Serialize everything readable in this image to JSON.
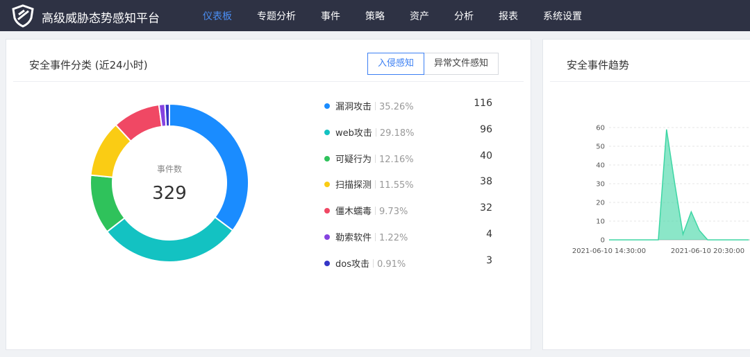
{
  "header": {
    "app_title": "高级威胁态势感知平台",
    "nav": [
      {
        "label": "仪表板",
        "active": true
      },
      {
        "label": "专题分析"
      },
      {
        "label": "事件"
      },
      {
        "label": "策略"
      },
      {
        "label": "资产"
      },
      {
        "label": "分析"
      },
      {
        "label": "报表"
      },
      {
        "label": "系统设置"
      }
    ]
  },
  "left_panel": {
    "title": "安全事件分类 (近24小时)",
    "tabs": [
      {
        "label": "入侵感知",
        "active": true
      },
      {
        "label": "异常文件感知"
      }
    ],
    "donut": {
      "label": "事件数",
      "total": "329"
    },
    "legend": [
      {
        "name": "漏洞攻击",
        "pct": "35.26%",
        "count": "116",
        "color": "#1a8cff"
      },
      {
        "name": "web攻击",
        "pct": "29.18%",
        "count": "96",
        "color": "#13c2c2"
      },
      {
        "name": "可疑行为",
        "pct": "12.16%",
        "count": "40",
        "color": "#2fc25b"
      },
      {
        "name": "扫描探测",
        "pct": "11.55%",
        "count": "38",
        "color": "#facc14"
      },
      {
        "name": "僵木蠕毒",
        "pct": "9.73%",
        "count": "32",
        "color": "#f04864"
      },
      {
        "name": "勒索软件",
        "pct": "1.22%",
        "count": "4",
        "color": "#8543e0"
      },
      {
        "name": "dos攻击",
        "pct": "0.91%",
        "count": "3",
        "color": "#3436c7"
      }
    ]
  },
  "right_panel": {
    "title": "安全事件趋势"
  },
  "chart_data": [
    {
      "type": "pie",
      "categories": [
        "漏洞攻击",
        "web攻击",
        "可疑行为",
        "扫描探测",
        "僵木蠕毒",
        "勒索软件",
        "dos攻击"
      ],
      "values": [
        116,
        96,
        40,
        38,
        32,
        4,
        3
      ],
      "colors": [
        "#1a8cff",
        "#13c2c2",
        "#2fc25b",
        "#facc14",
        "#f04864",
        "#8543e0",
        "#3436c7"
      ]
    },
    {
      "type": "area",
      "x_labels": [
        "2021-06-10 14:30:00",
        "2021-06-10 20:30:00"
      ],
      "y_ticks": [
        0,
        10,
        20,
        30,
        40,
        50,
        60
      ],
      "ylim": [
        0,
        60
      ],
      "x": [
        "2021-06-10 14:30:00",
        "2021-06-10 15:30:00",
        "2021-06-10 16:30:00",
        "2021-06-10 17:30:00",
        "2021-06-10 18:00:00",
        "2021-06-10 18:30:00",
        "2021-06-10 19:00:00",
        "2021-06-10 19:30:00",
        "2021-06-10 20:00:00",
        "2021-06-10 20:30:00",
        "2021-06-10 21:00:00",
        "2021-06-10 22:00:00",
        "2021-06-10 23:00:00"
      ],
      "values": [
        0,
        0,
        0,
        0,
        59,
        30,
        3,
        15,
        5,
        0,
        0,
        0,
        0
      ],
      "color": "#3dd6a4",
      "grid": true
    }
  ]
}
